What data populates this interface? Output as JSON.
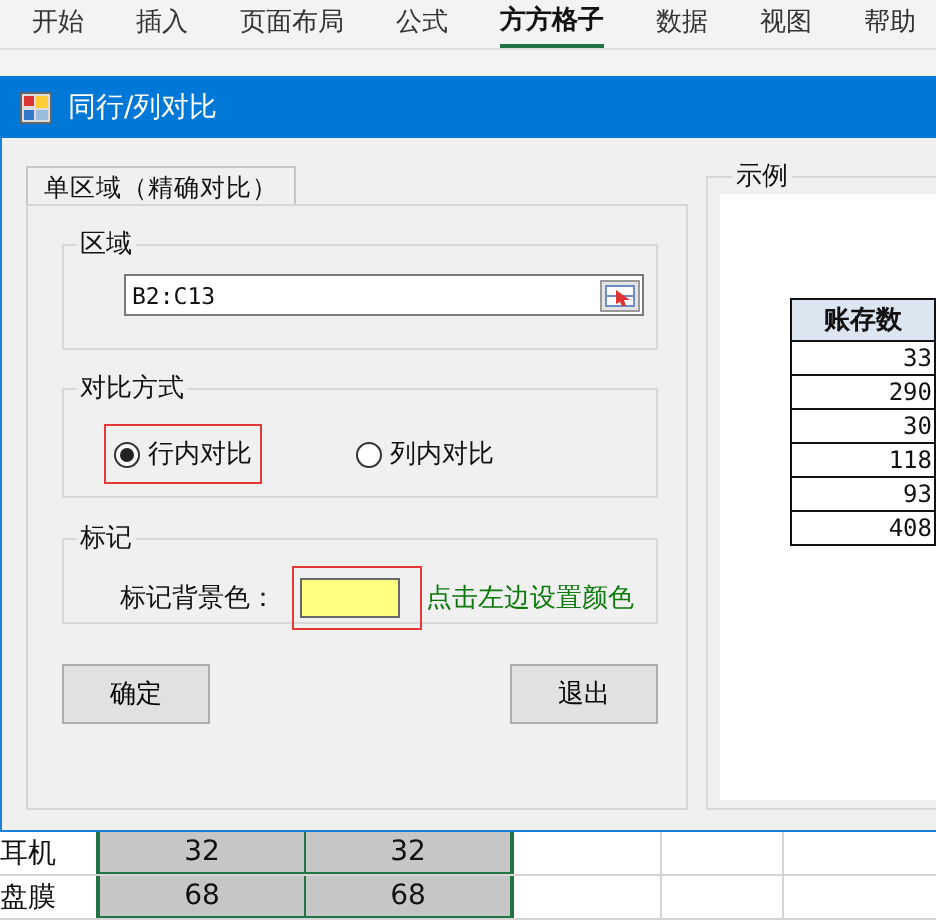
{
  "ribbon": {
    "tabs": [
      {
        "label": "开始",
        "selected": false
      },
      {
        "label": "插入",
        "selected": false
      },
      {
        "label": "页面布局",
        "selected": false
      },
      {
        "label": "公式",
        "selected": false
      },
      {
        "label": "方方格子",
        "selected": true
      },
      {
        "label": "数据",
        "selected": false
      },
      {
        "label": "视图",
        "selected": false
      },
      {
        "label": "帮助",
        "selected": false
      }
    ]
  },
  "dialog": {
    "title": "同行/列对比",
    "tabs": [
      {
        "label": "单区域（精确对比）",
        "selected": true
      }
    ],
    "range_group": {
      "title": "区域",
      "value": "B2:C13"
    },
    "mode_group": {
      "title": "对比方式",
      "options": [
        {
          "label": "行内对比",
          "selected": true
        },
        {
          "label": "列内对比",
          "selected": false
        }
      ]
    },
    "mark_group": {
      "title": "标记",
      "label": "标记背景色：",
      "color": "#ffff80",
      "hint": "点击左边设置颜色"
    },
    "buttons": [
      "确定",
      "退出"
    ],
    "example": {
      "title": "示例",
      "header": "账存数",
      "values": [
        "33",
        "290",
        "30",
        "118",
        "93",
        "408"
      ]
    }
  },
  "sheet": {
    "rows": [
      {
        "cells": [
          "耳机",
          "32",
          "32"
        ]
      },
      {
        "cells": [
          "盘膜",
          "68",
          "68"
        ]
      }
    ]
  }
}
